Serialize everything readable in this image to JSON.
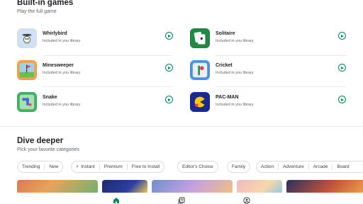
{
  "builtin": {
    "title": "Built-in games",
    "subtitle": "Play the full game",
    "games": [
      {
        "name": "Whirlybird",
        "sub": "Included in you library"
      },
      {
        "name": "Solitaire",
        "sub": "Included in you library"
      },
      {
        "name": "Minesweeper",
        "sub": "Included in you library"
      },
      {
        "name": "Cricket",
        "sub": "Included in you library"
      },
      {
        "name": "Snake",
        "sub": "Included in you library"
      },
      {
        "name": "PAC-MAN",
        "sub": "Included in you library"
      }
    ]
  },
  "dive": {
    "title": "Dive deeper",
    "subtitle": "Pick your favorite categories",
    "chips": {
      "trending": "Trending",
      "new": "New",
      "instant": "Instant",
      "premium": "Premium",
      "free_to_install": "Free to Install",
      "editors_choice": "Editor's Choice",
      "family": "Family",
      "action": "Action",
      "adventure": "Adventure",
      "arcade": "Arcade",
      "board": "Board"
    }
  },
  "nav": {
    "icons": [
      "home-icon",
      "library-icon",
      "account-icon"
    ],
    "active": "home-icon"
  },
  "colors": {
    "accent": "#01875f",
    "text": "#202124",
    "secondary": "#5f6368",
    "border": "#dadce0"
  }
}
